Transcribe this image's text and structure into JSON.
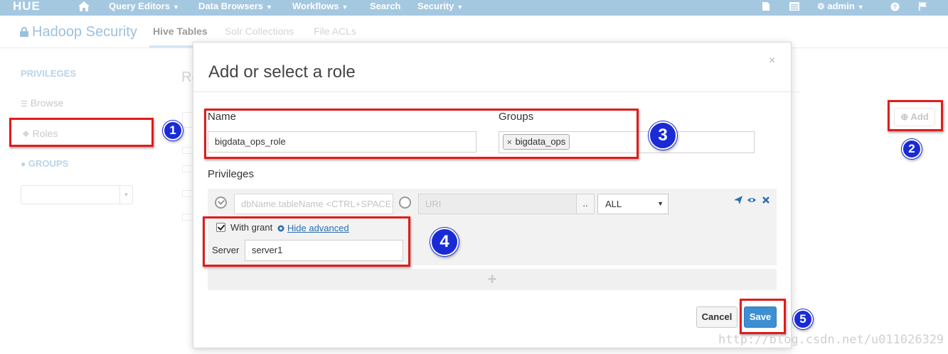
{
  "navbar": {
    "logo": "HUE",
    "items": [
      "Query Editors",
      "Data Browsers",
      "Workflows",
      "Search",
      "Security"
    ],
    "user": "admin",
    "icons": [
      "home-icon",
      "document-icon",
      "list-icon",
      "user-cog-icon",
      "help-icon",
      "flag-icon"
    ]
  },
  "header": {
    "title": "Hadoop Security",
    "tabs": [
      "Hive Tables",
      "Solr Collections",
      "File ACLs"
    ],
    "active_tab": "Hive Tables"
  },
  "sidebar": {
    "privileges_heading": "PRIVILEGES",
    "browse": "Browse",
    "roles": "Roles",
    "groups_heading": "GROUPS"
  },
  "background": {
    "heading_fragment": "Ro",
    "add_button": "Add"
  },
  "modal": {
    "title": "Add or select a role",
    "name_label": "Name",
    "name_value": "bigdata_ops_role",
    "groups_label": "Groups",
    "group_tag": "bigdata_ops",
    "privileges_label": "Privileges",
    "db_placeholder": "dbName.tableName <CTRL+SPACE>",
    "uri_placeholder": "URI",
    "dots_label": "..",
    "action_select": "ALL",
    "with_grant_label": "With grant",
    "with_grant_checked": true,
    "hide_advanced": "Hide advanced",
    "server_label": "Server",
    "server_value": "server1",
    "add_privilege": "+",
    "cancel": "Cancel",
    "save": "Save"
  },
  "annotations": [
    "1",
    "2",
    "3",
    "4",
    "5"
  ],
  "watermark": "http://blog.csdn.net/u011026329",
  "colors": {
    "navbar": "#a5c8e1",
    "annotation_red": "#e21b1b",
    "annotation_blue": "#1a2bd6",
    "save_button": "#3d8fd1",
    "link": "#2a6fb0"
  }
}
